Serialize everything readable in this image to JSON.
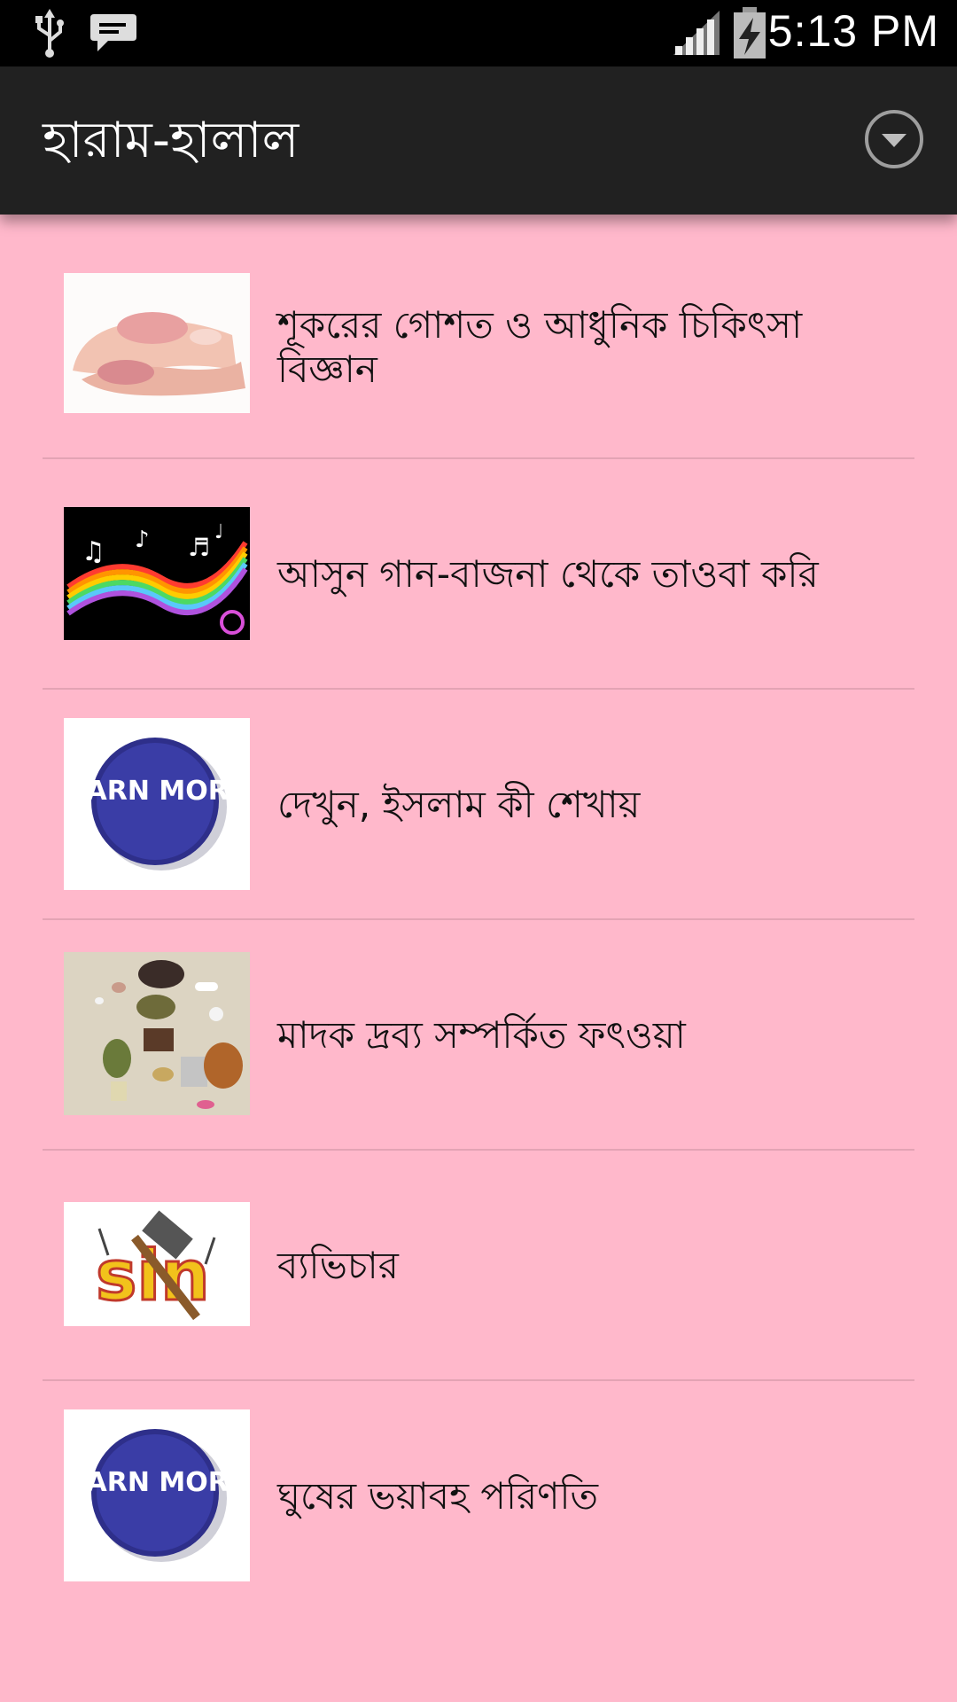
{
  "status_bar": {
    "time": "5:13 PM",
    "icons": [
      "usb-icon",
      "chat-icon",
      "signal-icon",
      "battery-charging-icon"
    ]
  },
  "action_bar": {
    "title": "হারাম-হালাল",
    "overflow_icon": "overflow-menu-icon"
  },
  "items": [
    {
      "label": "শূকরের গোশত ও আধুনিক চিকিৎসা বিজ্ঞান",
      "image": "pork-image"
    },
    {
      "label": "আসুন গান-বাজনা থেকে তাওবা করি",
      "image": "music-notes-image"
    },
    {
      "label": "দেখুন, ইসলাম কী শেখায়",
      "image": "learn-more-button-image",
      "image_text": "LEARN MORE!"
    },
    {
      "label": "মাদক দ্রব্য সম্পর্কিত ফৎওয়া",
      "image": "drugs-image"
    },
    {
      "label": "ব্যভিচার",
      "image": "sin-hammer-image",
      "image_text": "sin"
    },
    {
      "label": "ঘুষের ভয়াবহ পরিণতি",
      "image": "learn-more-button-image",
      "image_text": "LEARN MORE!"
    }
  ],
  "colors": {
    "background": "#ffb8cb",
    "action_bar": "#212121",
    "status_bar": "#000000",
    "divider": "#e3a3b4"
  }
}
